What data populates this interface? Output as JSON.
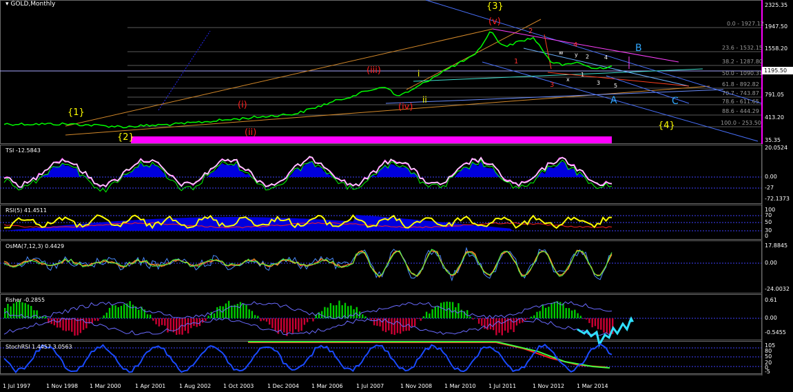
{
  "symbol": "GOLD,Monthly",
  "price_axis": [
    "2325.35",
    "1947.50",
    "1558.20",
    "791.05",
    "413.20",
    "35.35"
  ],
  "current_price": "1195.50",
  "fib_levels": [
    "0.0 - 1927.12",
    "23.6 - 1532.15",
    "38.2 - 1287.80",
    "50.0 - 1090.31",
    "61.8 - 892.82",
    "70.7 - 743.87",
    "78.6 - 611.65",
    "88.6 - 444.29",
    "100.0 - 253.50"
  ],
  "wave_labels": {
    "w1": "{1}",
    "w2": "{2}",
    "w3": "{3}",
    "w4": "{4}",
    "ri": "(i)",
    "rii": "(ii)",
    "riii": "(iii)",
    "riv": "(iv)",
    "rv": "(v)",
    "yi": "i",
    "yii": "ii",
    "A": "A",
    "B": "B",
    "C": "C",
    "A2": "A",
    "n1": "1",
    "n2": "2",
    "n3": "3",
    "n4": "4",
    "n5": "5",
    "nw": "w",
    "nx": "x",
    "ny": "y",
    "nx2": "x",
    "o1": "1",
    "o2": "2",
    "o4": "4",
    "o5": "5",
    "o3": "3"
  },
  "indicators": {
    "tsi": {
      "title": "TSI -12.5843",
      "axis": [
        "20.0524",
        "0.00",
        "-27",
        "-72.1373"
      ]
    },
    "rsi": {
      "title": "RSI(5) 41.4511",
      "axis": [
        "100",
        "70",
        "50",
        "30",
        "0"
      ]
    },
    "osma": {
      "title": "OsMA(7,12,3) 0.4429",
      "axis": [
        "17.8845",
        "0.00",
        "-24.0032"
      ]
    },
    "fisher": {
      "title": "Fisher -0.2855",
      "axis": [
        "0.61",
        "0.00",
        "-0.5455"
      ]
    },
    "stochrsi": {
      "title": "StochRSI 1.4457 3.0563",
      "axis": [
        "105",
        "80",
        "50",
        "20",
        "0",
        "-5"
      ]
    }
  },
  "time_axis": [
    "1 Jul 1997",
    "1 Nov 1998",
    "1 Mar 2000",
    "1 Apr 2001",
    "1 Aug 2002",
    "1 Oct 2003",
    "1 Dec 2004",
    "1 Mar 2006",
    "1 Jul 2007",
    "1 Nov 2008",
    "1 Mar 2010",
    "1 Jul 2011",
    "1 Nov 2012",
    "1 Mar 2014"
  ],
  "colors": {
    "background": "#000000",
    "candle_up": "#00ff00",
    "tsi_line": "#ff66ff",
    "histogram": "#0000ff",
    "volume": "#ff00ff",
    "fisher_up": "#00cc00",
    "fisher_down": "#cc0033",
    "rsi_line": "#ffff00"
  }
}
